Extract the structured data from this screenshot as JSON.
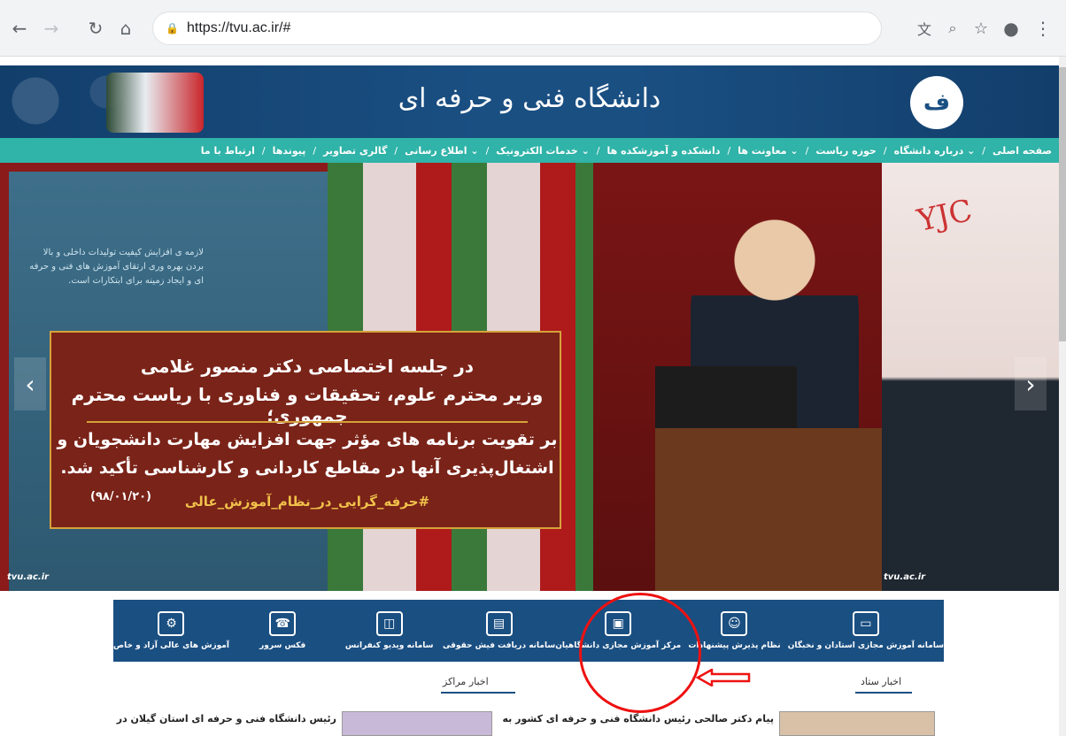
{
  "browser": {
    "url": "https://tvu.ac.ir/#"
  },
  "header": {
    "title": "دانشگاه فنی و حرفه ای",
    "logo_text": "ف"
  },
  "nav": {
    "items": [
      "صفحه اصلی",
      "درباره دانشگاه ⌄",
      "حوزه ریاست",
      "معاونت ها ⌄",
      "دانشکده و آموزشکده ها",
      "خدمات الکترونیک ⌄",
      "اطلاع رسانی ⌄",
      "گالری تصاویر",
      "پیوندها",
      "ارتباط با ما"
    ],
    "separator": "/"
  },
  "slider": {
    "caption_line1": "در جلسه اختصاصی دکتر منصور غلامی",
    "caption_line2": "وزیر محترم علوم، تحقیقات و فناوری با ریاست محترم جمهوری؛",
    "caption_line3": "بر تقویت برنامه های مؤثر جهت افزایش مهارت دانشجویان و",
    "caption_line4": "اشتغال‌پذیری آنها در مقاطع کاردانی و کارشناسی تأکید شد.",
    "hashtag": "#حرفه_گرایی_در_نظام_آموزش_عالی",
    "date": "(۹۸/۰۱/۲۰)",
    "panel_text": "لازمه ی افزایش کیفیت تولیدات داخلی و بالا بردن بهره وری ارتقای آموزش های فنی و حرفه ای و ایجاد زمینه برای ابتکارات است.",
    "watermark": "tvu.ac.ir",
    "yjc": "YJC",
    "prev_arrow": "‹",
    "next_arrow": "›"
  },
  "services": [
    {
      "label": "سامانه آموزش مجازی استادان و نخبگان",
      "icon": "monitor-icon",
      "glyph": "▭"
    },
    {
      "label": "نظام پذیرش پیشنهادات",
      "icon": "people-icon",
      "glyph": "☺"
    },
    {
      "label": "مرکز آموزش مجازی دانشگاهیان",
      "icon": "box-icon",
      "glyph": "▣"
    },
    {
      "label": "سامانه دریافت فیش حقوقی",
      "icon": "card-hand-icon",
      "glyph": "▤"
    },
    {
      "label": "سامانه ویدیو کنفرانس",
      "icon": "conference-icon",
      "glyph": "◫"
    },
    {
      "label": "فکس سرور",
      "icon": "fax-icon",
      "glyph": "☎"
    },
    {
      "label": "آموزش های عالی آزاد و خاص",
      "icon": "gears-icon",
      "glyph": "⚙"
    }
  ],
  "tabs": {
    "hq_news": "اخبار ستاد",
    "centers_news": "اخبار مراکز"
  },
  "news": {
    "item1": "پیام دکتر صالحی رئیس دانشگاه فنی و حرفه ای کشور به",
    "item2": "رئیس دانشگاه فنی و حرفه ای استان گیلان در"
  },
  "colors": {
    "header_blue": "#1a4f82",
    "nav_teal": "#30b3a8",
    "highlight_red": "#e11111"
  }
}
